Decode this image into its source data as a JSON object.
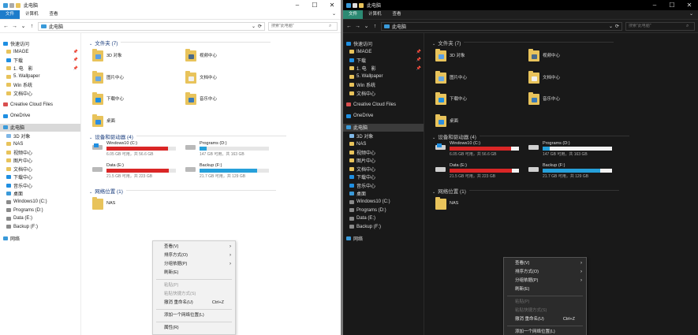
{
  "colors": {
    "accent_light": "#1d7ccb",
    "accent_dark": "#2c8a73",
    "drive_normal": "#26a0da",
    "drive_full": "#da2626",
    "folder": "#e8c35b"
  },
  "light": {
    "title": "此电脑",
    "ribbon": {
      "file": "文件",
      "computer": "计算机",
      "view": "查看"
    },
    "address": {
      "path": "此电脑",
      "search_placeholder": "搜索\"此电脑\""
    },
    "sidebar": [
      "快速访问",
      "IMAGE",
      "下载",
      "1. 电　影",
      "5. Wallpaper",
      "Win 系统",
      "文档中心",
      "Creative Cloud Files",
      "OneDrive",
      "此电脑",
      "3D 对象",
      "NAS",
      "视频中心",
      "图片中心",
      "文档中心",
      "下载中心",
      "音乐中心",
      "桌面",
      "Windows10 (C:)",
      "Programs (D:)",
      "Data (E:)",
      "Backup (F:)",
      "网络"
    ],
    "sections": {
      "folders": "文件夹 (7)",
      "drives": "设备和驱动器 (4)",
      "network": "网络位置 (1)"
    },
    "folders": [
      "3D 对象",
      "视频中心",
      "图片中心",
      "文档中心",
      "下载中心",
      "音乐中心",
      "桌面"
    ],
    "drives": [
      {
        "name": "Windows10 (C:)",
        "free": "6.05 GB 可用，共 56.6 GB",
        "used": 0.89
      },
      {
        "name": "Programs (D:)",
        "free": "147 GB 可用，共 163 GB",
        "used": 0.1
      },
      {
        "name": "Data (E:)",
        "free": "21.5 GB 可用，共 223 GB",
        "used": 0.9
      },
      {
        "name": "Backup (F:)",
        "free": "21.7 GB 可用，共 129 GB",
        "used": 0.83
      }
    ],
    "network": [
      "NAS"
    ],
    "menu": [
      "查看(V)",
      "排序方式(O)",
      "分组依据(P)",
      "刷新(E)",
      "粘贴(P)",
      "粘贴快捷方式(S)",
      "撤消 重命名(U)",
      "添加一个网络位置(L)",
      "属性(R)"
    ],
    "menu_shortcut": "Ctrl+Z"
  },
  "dark": {
    "title": "此电脑",
    "ribbon": {
      "file": "文件",
      "computer": "计算机",
      "view": "查看"
    },
    "address": {
      "path": "此电脑",
      "search_placeholder": "搜索\"此电脑\""
    },
    "sidebar": [
      "快速访问",
      "IMAGE",
      "下载",
      "1. 电　影",
      "5. Wallpaper",
      "Win 系统",
      "文档中心",
      "Creative Cloud Files",
      "OneDrive",
      "此电脑",
      "3D 对象",
      "NAS",
      "视频中心",
      "图片中心",
      "文档中心",
      "下载中心",
      "音乐中心",
      "桌面",
      "Windows10 (C:)",
      "Programs (D:)",
      "Data (E:)",
      "Backup (F:)",
      "网络"
    ],
    "sections": {
      "folders": "文件夹 (7)",
      "drives": "设备和驱动器 (4)",
      "network": "网络位置 (1)"
    },
    "folders": [
      "3D 对象",
      "视频中心",
      "图片中心",
      "文档中心",
      "下载中心",
      "音乐中心",
      "桌面"
    ],
    "drives": [
      {
        "name": "Windows10 (C:)",
        "free": "6.05 GB 可用，共 56.6 GB",
        "used": 0.89
      },
      {
        "name": "Programs (D:)",
        "free": "147 GB 可用，共 163 GB",
        "used": 0.1
      },
      {
        "name": "Data (E:)",
        "free": "21.5 GB 可用，共 223 GB",
        "used": 0.9
      },
      {
        "name": "Backup (F:)",
        "free": "21.7 GB 可用，共 129 GB",
        "used": 0.83
      }
    ],
    "network": [
      "NAS"
    ],
    "menu": [
      "查看(V)",
      "排序方式(O)",
      "分组依据(P)",
      "刷新(E)",
      "粘贴(P)",
      "粘贴快捷方式(S)",
      "撤消 重命名(U)",
      "添加一个网络位置(L)",
      "属性(R)"
    ],
    "menu_shortcut": "Ctrl+Z"
  }
}
